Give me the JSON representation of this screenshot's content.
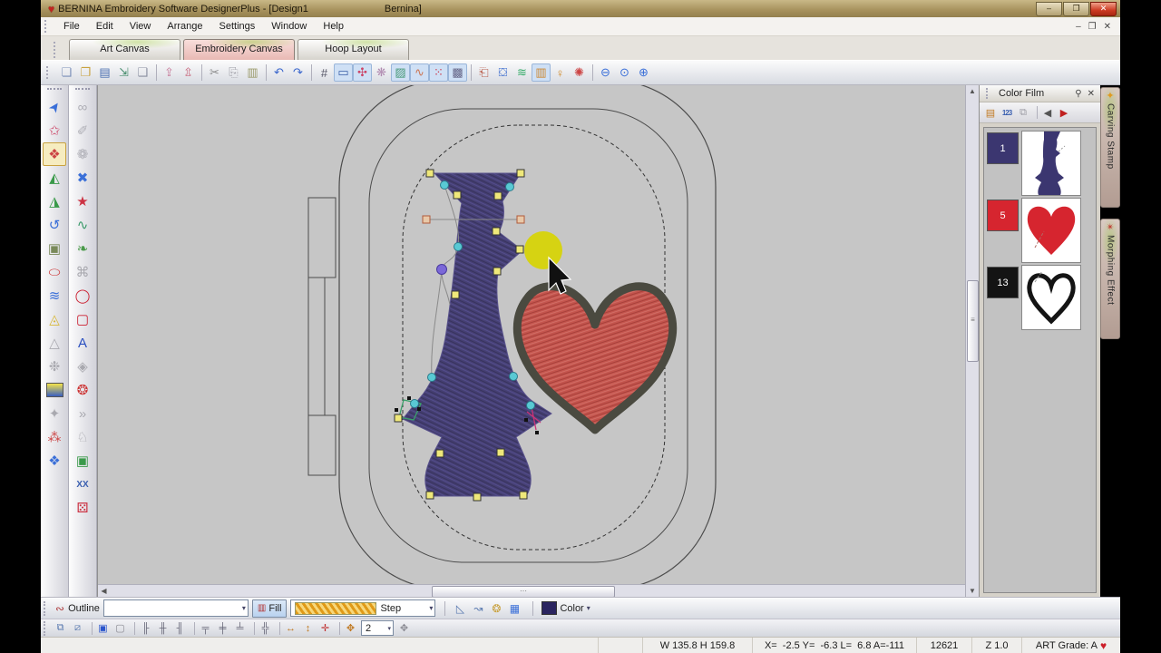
{
  "window": {
    "title_left": "BERNINA Embroidery Software DesignerPlus - [Design1",
    "title_right": "Bernina]",
    "logo_glyph": "♥",
    "buttons": {
      "minimize": "–",
      "restore": "❐",
      "close": "✕"
    }
  },
  "menu": {
    "items": [
      {
        "label": "File"
      },
      {
        "label": "Edit"
      },
      {
        "label": "View"
      },
      {
        "label": "Arrange"
      },
      {
        "label": "Settings"
      },
      {
        "label": "Window"
      },
      {
        "label": "Help"
      }
    ],
    "doc_controls": {
      "minimize": "–",
      "restore": "❐",
      "close": "✕"
    }
  },
  "canvas_tabs": {
    "art": "Art Canvas",
    "embroidery": "Embroidery Canvas",
    "hoop": "Hoop Layout"
  },
  "toolbar_top": {
    "icons": [
      {
        "cls": "ti",
        "name": "new-icon",
        "glyph": "❏",
        "color": "#7a8fb8"
      },
      {
        "cls": "ti",
        "name": "open-icon",
        "glyph": "❐",
        "color": "#c9a23f"
      },
      {
        "cls": "ti",
        "name": "save-icon",
        "glyph": "▤",
        "color": "#4a6fb0"
      },
      {
        "cls": "ti",
        "name": "export-icon",
        "glyph": "⇲",
        "color": "#4a8f6f"
      },
      {
        "cls": "ti",
        "name": "properties-icon",
        "glyph": "❑",
        "color": "#8a8fa0"
      },
      {
        "cls": "tsep"
      },
      {
        "cls": "ti",
        "name": "send-to-machine-icon",
        "glyph": "⇪",
        "color": "#c77b9a"
      },
      {
        "cls": "ti",
        "name": "write-to-card-icon",
        "glyph": "⇫",
        "color": "#c7667b"
      },
      {
        "cls": "tsep"
      },
      {
        "cls": "ti",
        "name": "cut-icon",
        "glyph": "✂",
        "color": "#8a8a8a"
      },
      {
        "cls": "ti",
        "name": "copy-icon",
        "glyph": "⎘",
        "color": "#9a9aa2"
      },
      {
        "cls": "ti",
        "name": "paste-icon",
        "glyph": "▥",
        "color": "#9a9a6a"
      },
      {
        "cls": "tsep"
      },
      {
        "cls": "ti",
        "name": "undo-icon",
        "glyph": "↶",
        "color": "#3a66cc"
      },
      {
        "cls": "ti",
        "name": "redo-icon",
        "glyph": "↷",
        "color": "#3a66cc"
      },
      {
        "cls": "tsep"
      },
      {
        "cls": "ti",
        "name": "grid-icon",
        "glyph": "#",
        "color": "#555566"
      },
      {
        "cls": "ti tihl",
        "name": "hoop-icon",
        "glyph": "▭",
        "color": "#3a5fa8"
      },
      {
        "cls": "ti tihl",
        "name": "show-stitches-icon",
        "glyph": "✣",
        "color": "#cc4466"
      },
      {
        "cls": "ti",
        "name": "show-outlines-icon",
        "glyph": "❋",
        "color": "#b08ab0"
      },
      {
        "cls": "ti tihl",
        "name": "show-picture-icon",
        "glyph": "▨",
        "color": "#4a9a7a"
      },
      {
        "cls": "ti tihl",
        "name": "stitch-player-icon",
        "glyph": "∿",
        "color": "#cc7755"
      },
      {
        "cls": "ti tihl",
        "name": "needle-points-icon",
        "glyph": "⁙",
        "color": "#cc3344"
      },
      {
        "cls": "ti tihl",
        "name": "connectors-icon",
        "glyph": "▩",
        "color": "#666688"
      },
      {
        "cls": "tsep"
      },
      {
        "cls": "ti",
        "name": "copy-design-icon",
        "glyph": "⎗",
        "color": "#bb6655"
      },
      {
        "cls": "ti",
        "name": "overview-window-icon",
        "glyph": "⛋",
        "color": "#3366cc"
      },
      {
        "cls": "ti",
        "name": "refresh-icon",
        "glyph": "≋",
        "color": "#33aa66"
      },
      {
        "cls": "ti tihl",
        "name": "thread-colors-icon",
        "glyph": "▥",
        "color": "#cc8833"
      },
      {
        "cls": "ti",
        "name": "design-properties-icon",
        "glyph": "♀",
        "color": "#d08a2a"
      },
      {
        "cls": "ti",
        "name": "pinwheel-icon",
        "glyph": "✺",
        "color": "#cc4444"
      },
      {
        "cls": "tsep"
      },
      {
        "cls": "ti",
        "name": "zoom-out-icon",
        "glyph": "⊖",
        "color": "#3a6fd8"
      },
      {
        "cls": "ti",
        "name": "zoom-icon",
        "glyph": "⊙",
        "color": "#3a6fd8"
      },
      {
        "cls": "ti",
        "name": "zoom-in-icon",
        "glyph": "⊕",
        "color": "#3a6fd8"
      }
    ]
  },
  "toolbox_a": {
    "icons": [
      {
        "cls": "li r315",
        "name": "select-tool-icon",
        "glyph": "➤",
        "color": "#3a6fd8"
      },
      {
        "cls": "li",
        "name": "polygon-select-icon",
        "glyph": "✩",
        "color": "#cc4466"
      },
      {
        "cls": "li sel",
        "name": "reshape-tool-icon",
        "glyph": "❖",
        "color": "#cc4444"
      },
      {
        "cls": "li",
        "name": "mirror-x-icon",
        "glyph": "◭",
        "color": "#3a9a4a"
      },
      {
        "cls": "li",
        "name": "mirror-y-icon",
        "glyph": "◮",
        "color": "#3a9a4a"
      },
      {
        "cls": "li",
        "name": "rotate-icon",
        "glyph": "↺",
        "color": "#3a6fd8"
      },
      {
        "cls": "li",
        "name": "background-icon",
        "glyph": "▣",
        "color": "#7a8a5a"
      },
      {
        "cls": "li",
        "name": "ellipse-outline-icon",
        "glyph": "⬭",
        "color": "#cc3333"
      },
      {
        "cls": "li",
        "name": "layers-icon",
        "glyph": "≋",
        "color": "#3a6fd8"
      },
      {
        "cls": "li",
        "name": "triangle-fill-icon",
        "glyph": "◬",
        "color": "#d8b83a"
      },
      {
        "cls": "li dis",
        "name": "triangle-gray-icon",
        "glyph": "△",
        "color": "#9a9aa2"
      },
      {
        "cls": "li dis",
        "name": "cluster-icon",
        "glyph": "❉",
        "color": "#9a9aa2"
      },
      {
        "cls": "li gradsq",
        "name": "gradient-fill-icon",
        "glyph": "",
        "color": ""
      },
      {
        "cls": "li dis",
        "name": "star-gray-icon",
        "glyph": "✦",
        "color": "#9a9aa2"
      },
      {
        "cls": "li",
        "name": "scatter-icon",
        "glyph": "⁂",
        "color": "#cc4444"
      },
      {
        "cls": "li",
        "name": "fan-icon",
        "glyph": "❖",
        "color": "#3a6fd8"
      }
    ]
  },
  "toolbox_b": {
    "icons": [
      {
        "cls": "li dis",
        "name": "magnifier-gray-icon",
        "glyph": "∞",
        "color": "#a0a0aa"
      },
      {
        "cls": "li dis",
        "name": "wand-icon",
        "glyph": "✐",
        "color": "#a0a0aa"
      },
      {
        "cls": "li dis",
        "name": "stamp-icon",
        "glyph": "❁",
        "color": "#a0a0aa"
      },
      {
        "cls": "li",
        "name": "cross-stitch-icon",
        "glyph": "✖",
        "color": "#3a6fd8"
      },
      {
        "cls": "li",
        "name": "star-red-icon",
        "glyph": "★",
        "color": "#cc3344"
      },
      {
        "cls": "li",
        "name": "squiggle-icon",
        "glyph": "∿",
        "color": "#3a9a6a"
      },
      {
        "cls": "li",
        "name": "freehand-icon",
        "glyph": "❧",
        "color": "#4a9a4a"
      },
      {
        "cls": "li dis",
        "name": "knot-icon",
        "glyph": "⌘",
        "color": "#9a9aa2"
      },
      {
        "cls": "li",
        "name": "circle-tool-icon",
        "glyph": "◯",
        "color": "#cc2233"
      },
      {
        "cls": "li",
        "name": "rectangle-tool-icon",
        "glyph": "▢",
        "color": "#cc2233"
      },
      {
        "cls": "li",
        "name": "lettering-icon",
        "glyph": "A",
        "color": "#2a4fc0"
      },
      {
        "cls": "li dis",
        "name": "diamond-icon",
        "glyph": "◈",
        "color": "#9a9aa2"
      },
      {
        "cls": "li",
        "name": "apple-icon",
        "glyph": "❂",
        "color": "#cc3333"
      },
      {
        "cls": "li dis",
        "name": "arrows-icon",
        "glyph": "»",
        "color": "#9a9aa2"
      },
      {
        "cls": "li dis",
        "name": "rabbit-icon",
        "glyph": "♘",
        "color": "#9a9aa2"
      },
      {
        "cls": "li",
        "name": "spiral-icon",
        "glyph": "▣",
        "color": "#3a9a4a"
      },
      {
        "cls": "li sm",
        "name": "monogram-icon",
        "glyph": "XX",
        "color": "#3a5fb0"
      },
      {
        "cls": "li",
        "name": "dice-icon",
        "glyph": "⚄",
        "color": "#cc3344"
      }
    ]
  },
  "scroll": {
    "up": "▲",
    "down": "▼",
    "left": "◀",
    "hgrip": "⋯",
    "vgrip": "≡"
  },
  "color_film": {
    "title": "Color Film",
    "pin_glyph": "⚲",
    "close_glyph": "✕",
    "toolbar": [
      {
        "cls": "cfi",
        "name": "thread-colors-icon",
        "glyph": "▤",
        "color": "#c07820"
      },
      {
        "cls": "cfi sm",
        "name": "color-sequence-icon",
        "glyph": "123",
        "color": "#3a5fb0"
      },
      {
        "cls": "cfi",
        "name": "group-colors-icon",
        "glyph": "⧉",
        "color": "#9a9aa2"
      },
      {
        "cls": "cfsep"
      },
      {
        "cls": "cfi",
        "name": "back-icon",
        "glyph": "◀",
        "color": "#555555"
      },
      {
        "cls": "cfi",
        "name": "play-icon",
        "glyph": "▶",
        "color": "#c02020"
      }
    ],
    "items": [
      {
        "sequence": "1",
        "swatch": "#3b3670"
      },
      {
        "sequence": "5",
        "swatch": "#d6252f"
      },
      {
        "sequence": "13",
        "swatch": "#141414"
      }
    ]
  },
  "side_tabs": [
    {
      "label": "Carving Stamp",
      "icon_glyph": "✦",
      "icon_color": "#e09a20"
    },
    {
      "label": "Morphing Effect",
      "icon_glyph": "✴",
      "icon_color": "#c0443a"
    }
  ],
  "properties_bar": {
    "outline_icon": "∾",
    "outline_label": "Outline",
    "outline_value": "",
    "fill_icon": "▥",
    "fill_label": "Fill",
    "stitch_type": "Step",
    "arrow": "▾",
    "icons": [
      {
        "cls": "pi",
        "name": "open-object-icon",
        "glyph": "◺",
        "color": "#5a7ab0"
      },
      {
        "cls": "pi",
        "name": "closed-object-icon",
        "glyph": "↝",
        "color": "#5a7ab0"
      },
      {
        "cls": "pi",
        "name": "fancy-fill-icon",
        "glyph": "❂",
        "color": "#c9a23f"
      },
      {
        "cls": "pi",
        "name": "pattern-fill-icon",
        "glyph": "▦",
        "color": "#3a6fd8"
      }
    ],
    "color_label": "Color",
    "color_value": "#2b2560"
  },
  "arrange_bar": {
    "icons": [
      {
        "cls": "ai",
        "name": "group-icon",
        "glyph": "⧉",
        "color": "#5a7ab0"
      },
      {
        "cls": "ai",
        "name": "ungroup-icon",
        "glyph": "⧄",
        "color": "#5a7ab0"
      },
      {
        "cls": "asep"
      },
      {
        "cls": "ai",
        "name": "lock-icon",
        "glyph": "▣",
        "color": "#2a55cc"
      },
      {
        "cls": "ai",
        "name": "unlock-icon",
        "glyph": "▢",
        "color": "#8a8a92"
      },
      {
        "cls": "asep"
      },
      {
        "cls": "ai",
        "name": "align-left-icon",
        "glyph": "╟",
        "color": "#666677"
      },
      {
        "cls": "ai",
        "name": "align-center-icon",
        "glyph": "╫",
        "color": "#666677"
      },
      {
        "cls": "ai",
        "name": "align-right-icon",
        "glyph": "╢",
        "color": "#666677"
      },
      {
        "cls": "asep"
      },
      {
        "cls": "ai",
        "name": "align-top-icon",
        "glyph": "╤",
        "color": "#666677"
      },
      {
        "cls": "ai",
        "name": "align-middle-icon",
        "glyph": "╪",
        "color": "#666677"
      },
      {
        "cls": "ai",
        "name": "align-bottom-icon",
        "glyph": "╧",
        "color": "#666677"
      },
      {
        "cls": "asep"
      },
      {
        "cls": "ai",
        "name": "center-design-icon",
        "glyph": "╬",
        "color": "#666677"
      },
      {
        "cls": "asep"
      },
      {
        "cls": "ai",
        "name": "space-horizontal-icon",
        "glyph": "↔",
        "color": "#c07820"
      },
      {
        "cls": "ai",
        "name": "space-vertical-icon",
        "glyph": "↕",
        "color": "#c07820"
      },
      {
        "cls": "ai",
        "name": "resize-icon",
        "glyph": "✛",
        "color": "#c03030"
      },
      {
        "cls": "asep"
      },
      {
        "cls": "ai",
        "name": "nudge-icon",
        "glyph": "✥",
        "color": "#c07820"
      }
    ],
    "spin_value": "2",
    "spin_arrow": "▾",
    "move_icon": {
      "glyph": "✥",
      "color": "#8a8a92"
    }
  },
  "status_bar": {
    "size": "W 135.8 H 159.8",
    "position": "X=  -2.5 Y=  -6.3 L=  6.8 A=-111",
    "stitch_count": "12621",
    "zoom": "Z 1.0",
    "grade": "ART Grade: A",
    "grade_heart": "♥"
  },
  "design": {
    "colors": {
      "vase_fill": "#453f72",
      "heart_fill": "#c4544d",
      "heart_outline": "#4a4a40",
      "highlight_circle": "#d6d312",
      "canvas_bg": "#c6c6c6"
    }
  }
}
